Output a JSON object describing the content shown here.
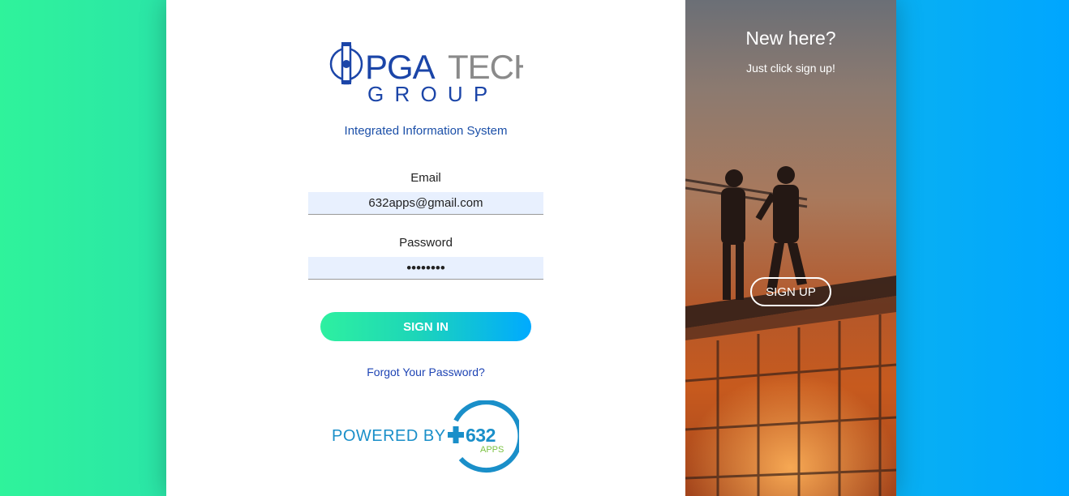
{
  "logo": {
    "brand_main": "PGA",
    "brand_tech": "TECH",
    "brand_group": "G R O U P",
    "colors": {
      "primary": "#1b45a8",
      "secondary": "#8a8a8a"
    }
  },
  "subtitle": "Integrated Information System",
  "form": {
    "email_label": "Email",
    "email_value": "632apps@gmail.com",
    "password_label": "Password",
    "password_value": "••••••••",
    "signin_label": "SIGN IN",
    "forgot_label": "Forgot Your Password?"
  },
  "powered": {
    "label": "POWERED BY",
    "badge_number": "632",
    "badge_apps": "APPS",
    "badge_plus_icon": "plus-icon"
  },
  "right_panel": {
    "heading": "New here?",
    "tagline": "Just click sign up!",
    "signup_label": "SIGN UP"
  },
  "colors": {
    "accent_green": "#2ff39b",
    "accent_blue": "#00a6ff",
    "link": "#1e44b4"
  }
}
